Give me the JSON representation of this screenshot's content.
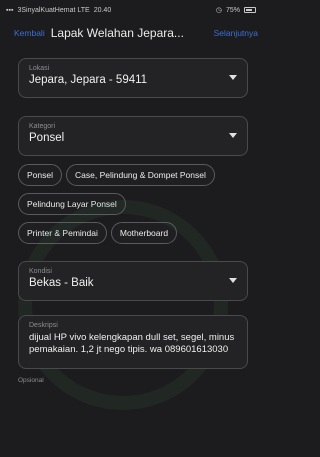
{
  "status": {
    "carrier": "3SinyalKuatHemat LTE",
    "time": "20.40",
    "battery": "75%"
  },
  "nav": {
    "back_label": "Kembali",
    "title": "Lapak Welahan Jepara...",
    "next_label": "Selanjutnya"
  },
  "location": {
    "label": "Lokasi",
    "value": "Jepara, Jepara - 59411"
  },
  "category": {
    "label": "Kategori",
    "value": "Ponsel"
  },
  "chips": [
    "Ponsel",
    "Case, Pelindung & Dompet Ponsel",
    "Pelindung Layar Ponsel",
    "Printer & Pemindai",
    "Motherboard"
  ],
  "condition": {
    "label": "Kondisi",
    "value": "Bekas - Baik"
  },
  "description": {
    "label": "Deskripsi",
    "value": "dijual HP vivo kelengkapan dull set, segel, minus pemakaian. 1,2 jt nego tipis. wa 089601613030"
  },
  "optional_label": "Opsional"
}
